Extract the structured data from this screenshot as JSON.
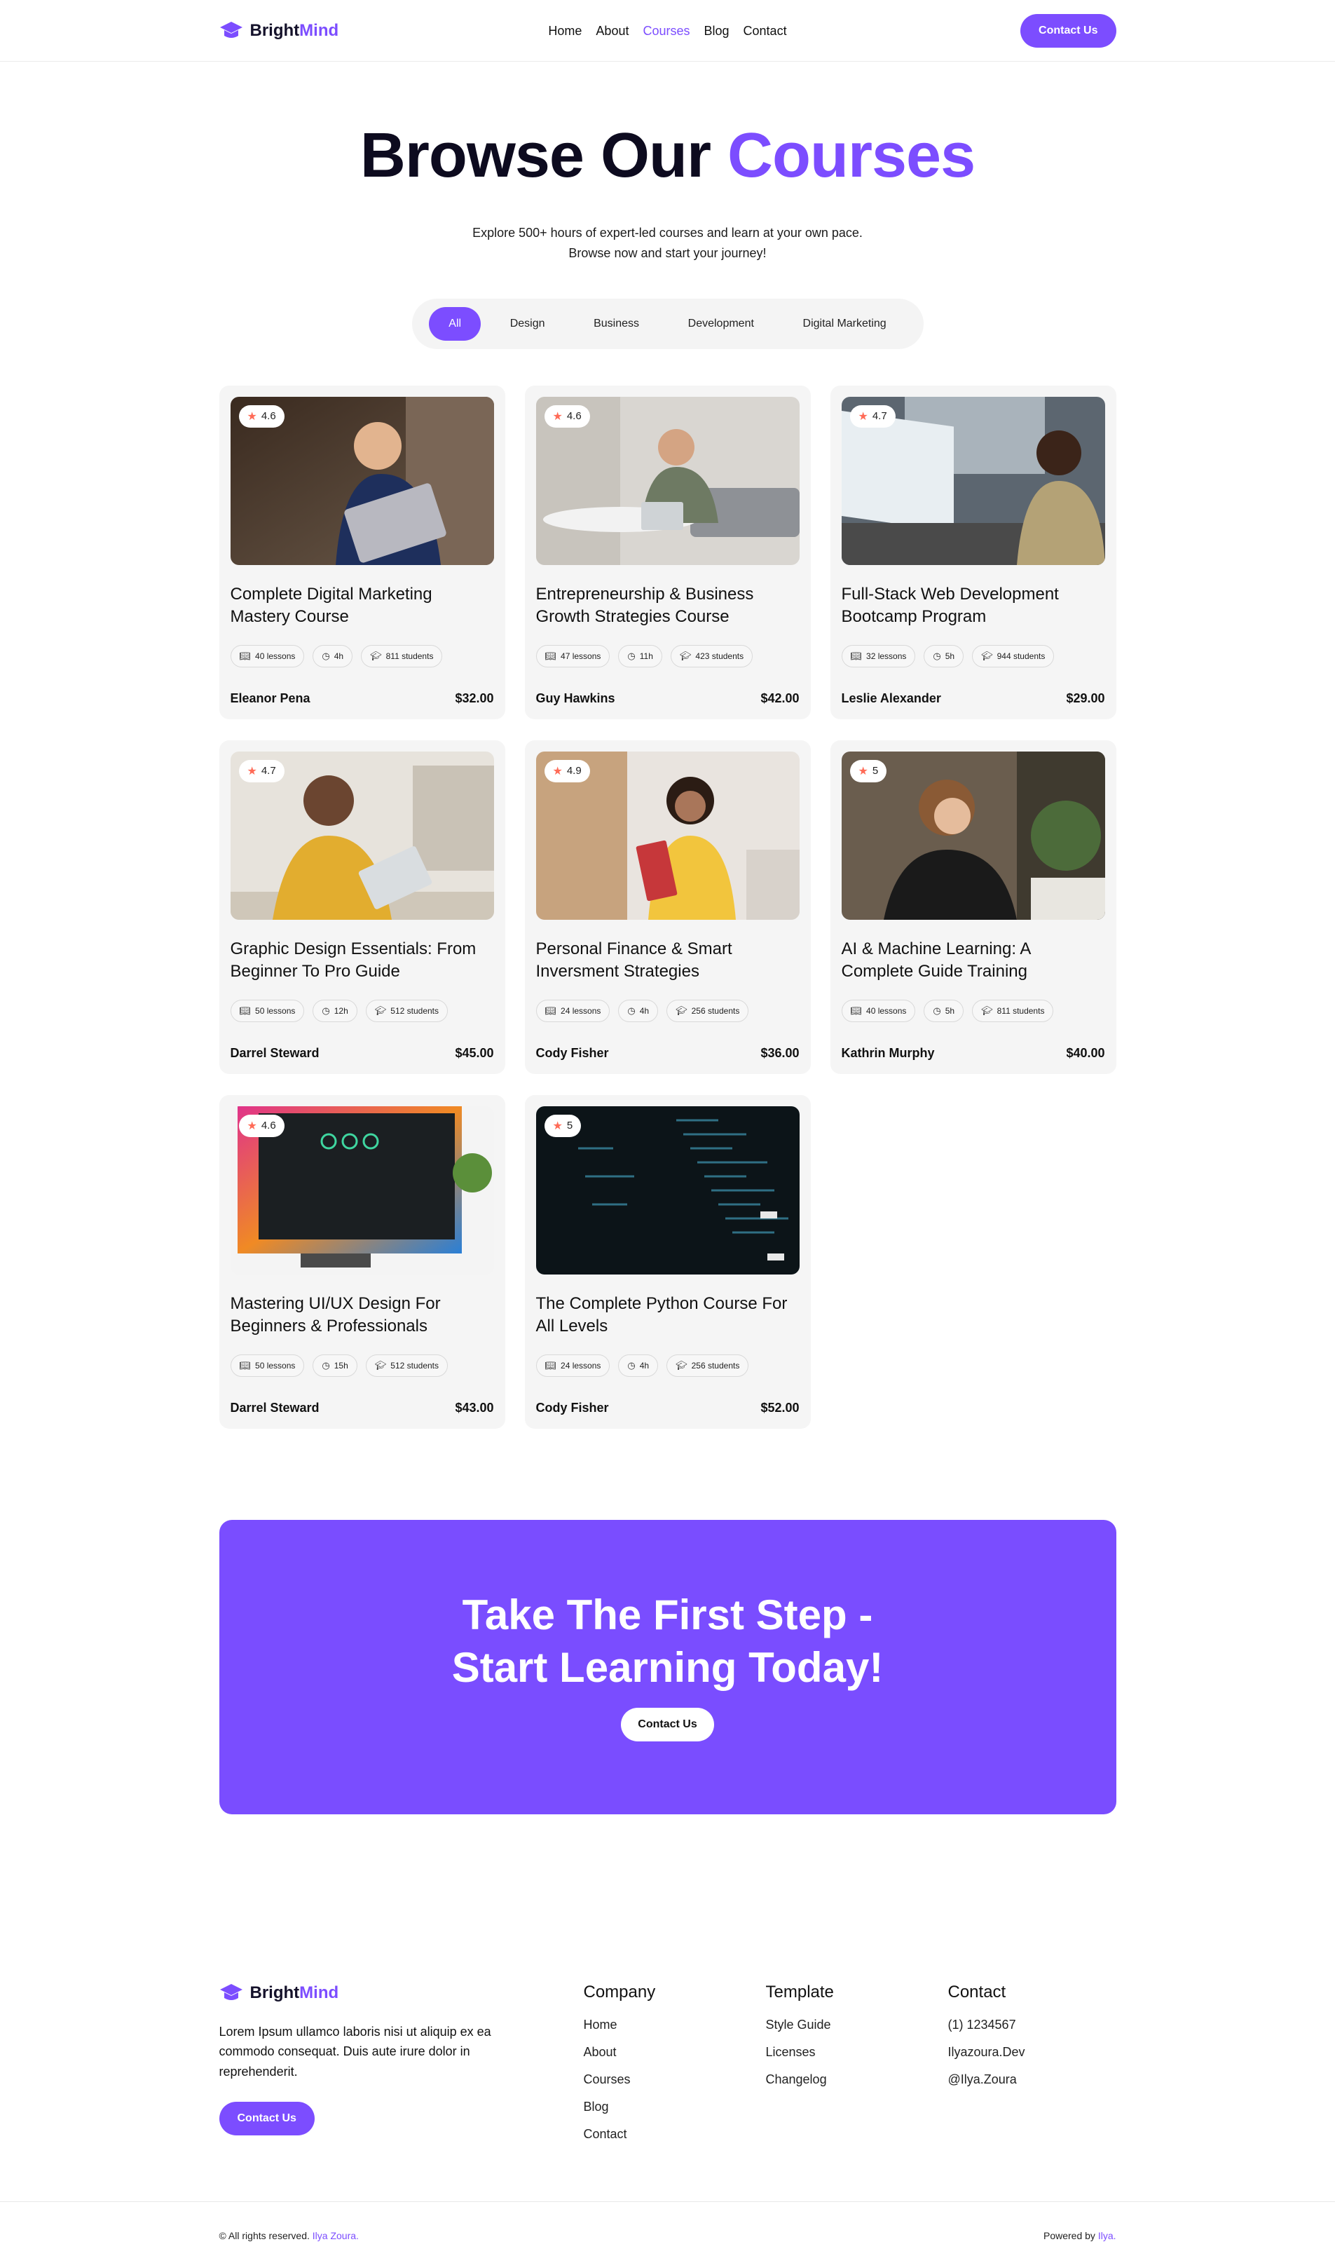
{
  "brand": {
    "part1": "Bright",
    "part2": "Mind"
  },
  "nav": {
    "items": [
      {
        "label": "Home",
        "active": false
      },
      {
        "label": "About",
        "active": false
      },
      {
        "label": "Courses",
        "active": true
      },
      {
        "label": "Blog",
        "active": false
      },
      {
        "label": "Contact",
        "active": false
      }
    ],
    "cta": "Contact Us"
  },
  "hero": {
    "title_main": "Browse Our",
    "title_accent": "Courses",
    "subtitle": "Explore 500+ hours of expert-led courses and learn at your own pace. Browse now and start your journey!"
  },
  "filters": [
    "All",
    "Design",
    "Business",
    "Development",
    "Digital Marketing"
  ],
  "courses": [
    {
      "rating": "4.6",
      "title": "Complete Digital Marketing Mastery Course",
      "lessons": "40 lessons",
      "hours": "4h",
      "students": "811 students",
      "instructor": "Eleanor Pena",
      "price": "$32.00",
      "image": "person-with-laptop-photo"
    },
    {
      "rating": "4.6",
      "title": "Entrepreneurship & Business Growth Strategies Course",
      "lessons": "47 lessons",
      "hours": "11h",
      "students": "423 students",
      "instructor": "Guy Hawkins",
      "price": "$42.00",
      "image": "man-with-tablet-photo"
    },
    {
      "rating": "4.7",
      "title": "Full-Stack Web Development Bootcamp Program",
      "lessons": "32 lessons",
      "hours": "5h",
      "students": "944 students",
      "instructor": "Leslie Alexander",
      "price": "$29.00",
      "image": "woman-at-computer-photo"
    },
    {
      "rating": "4.7",
      "title": "Graphic Design Essentials: From Beginner To Pro Guide",
      "lessons": "50 lessons",
      "hours": "12h",
      "students": "512 students",
      "instructor": "Darrel Steward",
      "price": "$45.00",
      "image": "man-with-tablet-yellow-photo"
    },
    {
      "rating": "4.9",
      "title": "Personal Finance & Smart Inversment Strategies",
      "lessons": "24 lessons",
      "hours": "4h",
      "students": "256 students",
      "instructor": "Cody Fisher",
      "price": "$36.00",
      "image": "woman-with-books-photo"
    },
    {
      "rating": "5",
      "title": "AI & Machine Learning: A Complete Guide Training",
      "lessons": "40 lessons",
      "hours": "5h",
      "students": "811 students",
      "instructor": "Kathrin Murphy",
      "price": "$40.00",
      "image": "woman-thinking-photo"
    },
    {
      "rating": "4.6",
      "title": "Mastering UI/UX Design For Beginners & Professionals",
      "lessons": "50 lessons",
      "hours": "15h",
      "students": "512 students",
      "instructor": "Darrel Steward",
      "price": "$43.00",
      "image": "monitor-ui-photo"
    },
    {
      "rating": "5",
      "title": "The Complete Python Course For All Levels",
      "lessons": "24 lessons",
      "hours": "4h",
      "students": "256 students",
      "instructor": "Cody Fisher",
      "price": "$52.00",
      "image": "code-screen-photo"
    }
  ],
  "cta": {
    "line1": "Take The First Step -",
    "line2": "Start Learning Today!",
    "button": "Contact Us"
  },
  "footer": {
    "description": "Lorem Ipsum ullamco laboris nisi ut aliquip ex ea commodo consequat. Duis aute irure dolor in reprehenderit.",
    "button": "Contact Us",
    "columns": [
      {
        "title": "Company",
        "links": [
          "Home",
          "About",
          "Courses",
          "Blog",
          "Contact"
        ]
      },
      {
        "title": "Template",
        "links": [
          "Style Guide",
          "Licenses",
          "Changelog"
        ]
      },
      {
        "title": "Contact",
        "links": [
          "(1) 1234567",
          "Ilyazoura.Dev",
          "@Ilya.Zoura"
        ]
      }
    ],
    "copyright": "© All rights reserved.",
    "copyright_author": "Ilya Zoura.",
    "powered": "Powered by",
    "powered_author": "Ilya."
  },
  "colors": {
    "accent": "#7c4dff",
    "cta_bg": "#7a4dff",
    "card_bg": "#f5f5f5",
    "star": "#ff6b57"
  }
}
